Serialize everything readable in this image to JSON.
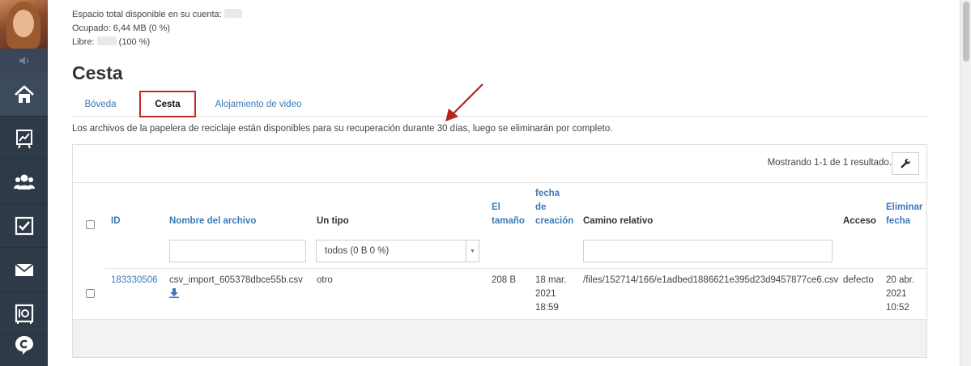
{
  "storage": {
    "total_label": "Espacio total disponible en su cuenta:",
    "used_label": "Ocupado:",
    "used_value": "6,44 MB (0 %)",
    "free_label": "Libre:",
    "free_value": "(100 %)"
  },
  "page_title": "Cesta",
  "tabs": [
    {
      "label": "Bóveda",
      "active": false
    },
    {
      "label": "Cesta",
      "active": true
    },
    {
      "label": "Alojamiento de video",
      "active": false
    }
  ],
  "note": "Los archivos de la papelera de reciclaje están disponibles para su recuperación durante 30 días, luego se eliminarán por completo.",
  "table": {
    "result_count": "Mostrando 1-1 de 1 resultado.",
    "headers": {
      "id": "ID",
      "filename": "Nombre del archivo",
      "type": "Un tipo",
      "size_1": "El",
      "size_2": "tamaño",
      "created_1": "fecha",
      "created_2": "de",
      "created_3": "creación",
      "path": "Camino relativo",
      "access": "Acceso",
      "deleted_1": "Eliminar",
      "deleted_2": "fecha"
    },
    "type_filter": "todos (0 B 0 %)",
    "rows": [
      {
        "id": "183330506",
        "filename": "csv_import_605378dbce55b.csv",
        "type": "otro",
        "size": "208 B",
        "created_1": "18 mar.",
        "created_2": "2021",
        "created_3": "18:59",
        "path": "/files/152714/166/e1adbed1886621e395d23d9457877ce6.csv",
        "access": "defecto",
        "deleted_1": "20 abr.",
        "deleted_2": "2021",
        "deleted_3": "10:52"
      }
    ]
  },
  "colors": {
    "sidebar": "#2f3a48",
    "link": "#3a7ab8",
    "highlight": "#c22a2a"
  }
}
